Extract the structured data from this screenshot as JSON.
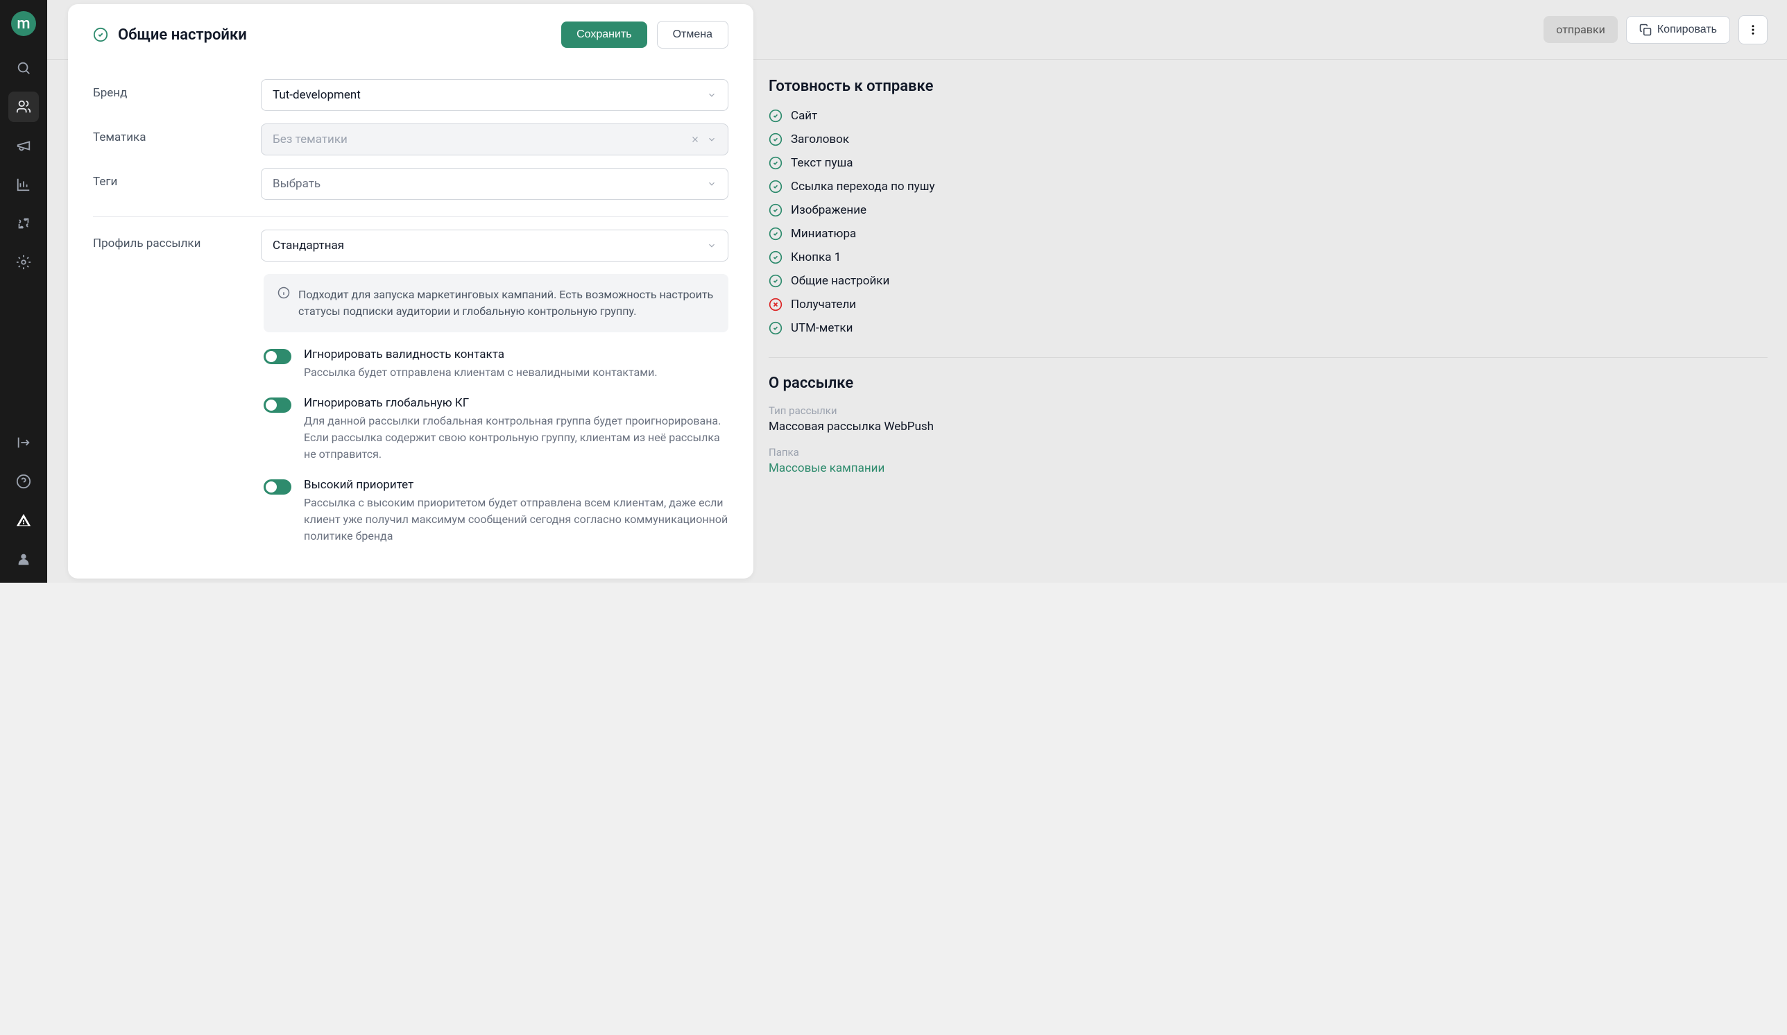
{
  "logo": "m",
  "topbar": {
    "tab": "отправки",
    "copy": "Копировать"
  },
  "panel": {
    "title": "Общие настройки",
    "save": "Сохранить",
    "cancel": "Отмена"
  },
  "form": {
    "brand_label": "Бренд",
    "brand_value": "Tut-development",
    "theme_label": "Тематика",
    "theme_value": "Без тематики",
    "tags_label": "Теги",
    "tags_placeholder": "Выбрать",
    "profile_label": "Профиль рассылки",
    "profile_value": "Стандартная",
    "info_text": "Подходит для запуска маркетинговых кампаний. Есть возможность настроить статусы подписки аудитории и глобальную контрольную группу.",
    "toggles": [
      {
        "title": "Игнорировать валидность контакта",
        "desc": "Рассылка будет отправлена клиентам с невалидными контактами."
      },
      {
        "title": "Игнорировать глобальную КГ",
        "desc": "Для данной рассылки глобальная контрольная группа будет проигнорирована. Если рассылка содержит свою контрольную группу, клиентам из неё рассылка не отправится."
      },
      {
        "title": "Высокий приоритет",
        "desc": "Рассылка с высоким приоритетом будет отправлена всем клиентам, даже если клиент уже получил максимум сообщений сегодня согласно коммуникационной политике бренда"
      }
    ]
  },
  "aside": {
    "readiness_title": "Готовность к отправке",
    "items": [
      {
        "label": "Сайт",
        "ok": true
      },
      {
        "label": "Заголовок",
        "ok": true
      },
      {
        "label": "Текст пуша",
        "ok": true
      },
      {
        "label": "Ссылка перехода по пушу",
        "ok": true
      },
      {
        "label": "Изображение",
        "ok": true
      },
      {
        "label": "Миниатюра",
        "ok": true
      },
      {
        "label": "Кнопка 1",
        "ok": true
      },
      {
        "label": "Общие настройки",
        "ok": true
      },
      {
        "label": "Получатели",
        "ok": false
      },
      {
        "label": "UTM-метки",
        "ok": true
      }
    ],
    "about_title": "О рассылке",
    "type_label": "Тип рассылки",
    "type_value": "Массовая рассылка WebPush",
    "folder_label": "Папка",
    "folder_value": "Массовые кампании"
  }
}
